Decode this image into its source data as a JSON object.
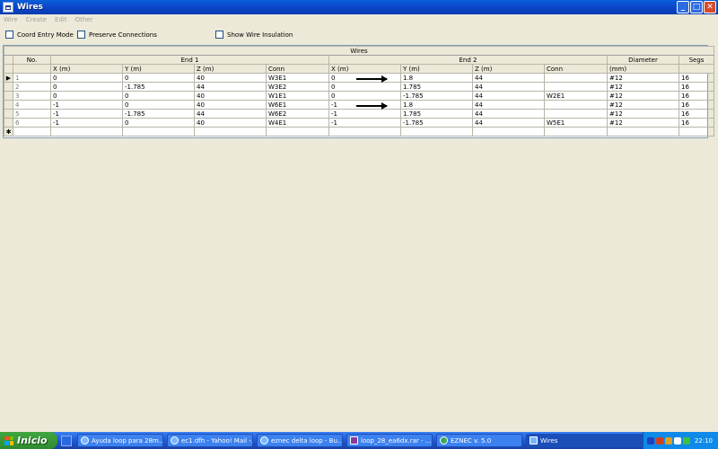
{
  "window": {
    "title": "Wires"
  },
  "menu": [
    "Wire",
    "Create",
    "Edit",
    "Other"
  ],
  "options": {
    "coord_entry": "Coord Entry Mode",
    "preserve_connections": "Preserve Connections",
    "show_insulation": "Show Wire Insulation"
  },
  "table": {
    "caption": "Wires",
    "group_headers": {
      "no": "No.",
      "end1": "End 1",
      "end2": "End 2",
      "diameter": "Diameter",
      "segs": "Segs"
    },
    "sub_headers": {
      "x": "X (m)",
      "y": "Y (m)",
      "z": "Z (m)",
      "conn": "Conn",
      "dia_unit": "(mm)"
    },
    "rows": [
      {
        "no": "1",
        "x1": "0",
        "y1": "0",
        "z1": "40",
        "c1": "W3E1",
        "x2": "0",
        "y2": "1.8",
        "z2": "44",
        "c2": "",
        "dia": "#12",
        "segs": "16"
      },
      {
        "no": "2",
        "x1": "0",
        "y1": "-1.785",
        "z1": "44",
        "c1": "W3E2",
        "x2": "0",
        "y2": "1.785",
        "z2": "44",
        "c2": "",
        "dia": "#12",
        "segs": "16"
      },
      {
        "no": "3",
        "x1": "0",
        "y1": "0",
        "z1": "40",
        "c1": "W1E1",
        "x2": "0",
        "y2": "-1.785",
        "z2": "44",
        "c2": "W2E1",
        "dia": "#12",
        "segs": "16"
      },
      {
        "no": "4",
        "x1": "-1",
        "y1": "0",
        "z1": "40",
        "c1": "W6E1",
        "x2": "-1",
        "y2": "1.8",
        "z2": "44",
        "c2": "",
        "dia": "#12",
        "segs": "16"
      },
      {
        "no": "5",
        "x1": "-1",
        "y1": "-1.785",
        "z1": "44",
        "c1": "W6E2",
        "x2": "-1",
        "y2": "1.785",
        "z2": "44",
        "c2": "",
        "dia": "#12",
        "segs": "16"
      },
      {
        "no": "6",
        "x1": "-1",
        "y1": "0",
        "z1": "40",
        "c1": "W4E1",
        "x2": "-1",
        "y2": "-1.785",
        "z2": "44",
        "c2": "W5E1",
        "dia": "#12",
        "segs": "16"
      }
    ],
    "current_row_marker": "▶",
    "new_row_marker": "✱"
  },
  "taskbar": {
    "start_label": "Inicio",
    "tasks": [
      {
        "label": "Ayuda loop para 28m..."
      },
      {
        "label": "ec1.dfh - Yahoo! Mail -..."
      },
      {
        "label": "eznec delta loop - Bu..."
      },
      {
        "label": "loop_28_ea6dx.rar - ..."
      },
      {
        "label": "EZNEC v. 5.0"
      },
      {
        "label": "Wires"
      }
    ],
    "clock": "22:10"
  }
}
